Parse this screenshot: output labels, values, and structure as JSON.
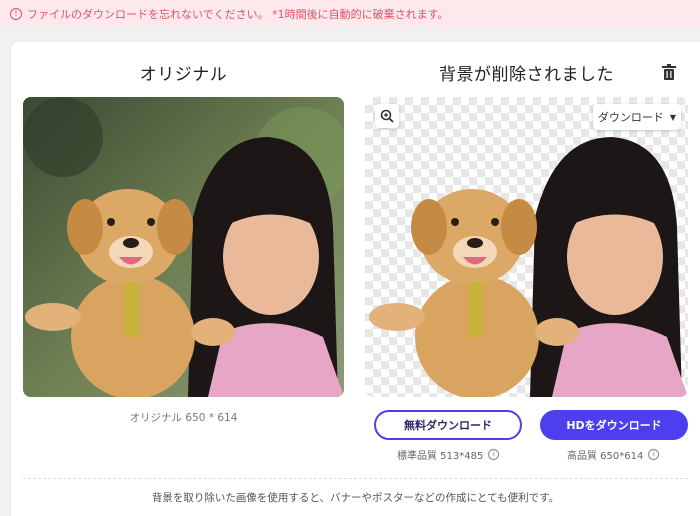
{
  "alert": {
    "text": "ファイルのダウンロードを忘れないでください。 *1時間後に自動的に破棄されます。"
  },
  "panels": {
    "original_title": "オリジナル",
    "result_title": "背景が削除されました",
    "original_size": "オリジナル 650 * 614"
  },
  "result": {
    "download_menu_label": "ダウンロード",
    "free_download_label": "無料ダウンロード",
    "hd_download_label": "HDをダウンロード",
    "standard_quality": "標準品質 513*485",
    "high_quality": "高品質 650*614"
  },
  "footer": {
    "note": "背景を取り除いた画像を使用すると、バナーやポスターなどの作成にとても便利です。"
  },
  "colors": {
    "accent": "#4d3ff0",
    "alert_bg": "#fde9ec",
    "alert_text": "#e2506a"
  },
  "icons": {
    "alert": "info-circle-icon",
    "delete": "trash-icon",
    "zoom": "zoom-in-icon",
    "dropdown": "caret-down-icon",
    "quality_info": "info-circle-icon"
  }
}
